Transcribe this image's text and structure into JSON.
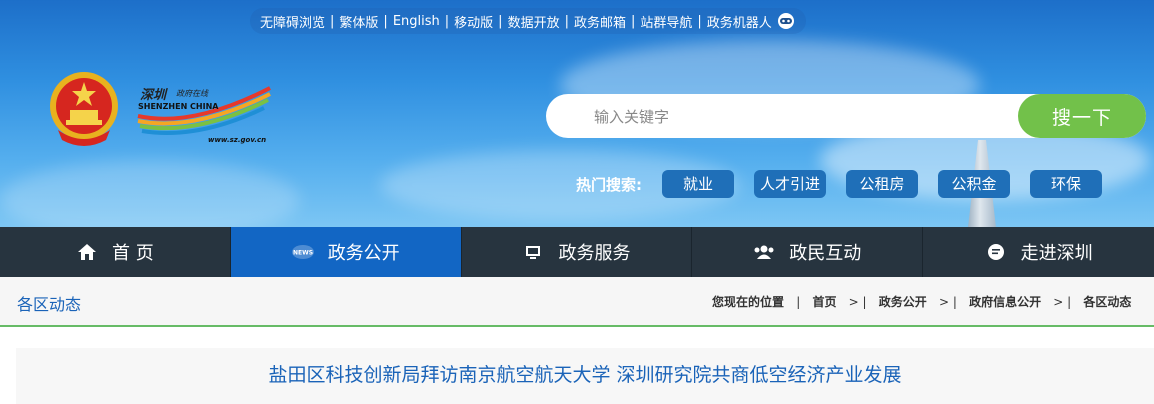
{
  "topbar": {
    "links": [
      "无障碍浏览",
      "繁体版",
      "English",
      "移动版",
      "数据开放",
      "政务邮箱",
      "站群导航",
      "政务机器人"
    ]
  },
  "logo": {
    "chinese": "深圳",
    "tagline": "政府在线",
    "english": "SHENZHEN CHINA",
    "url": "www.sz.gov.cn"
  },
  "search": {
    "placeholder": "输入关键字",
    "button": "搜一下"
  },
  "hot": {
    "label": "热门搜索:",
    "tags": [
      "就业",
      "人才引进",
      "公租房",
      "公积金",
      "环保"
    ]
  },
  "nav": {
    "items": [
      {
        "label": "首 页",
        "icon": "home-icon"
      },
      {
        "label": "政务公开",
        "icon": "news-icon"
      },
      {
        "label": "政务服务",
        "icon": "monitor-icon"
      },
      {
        "label": "政民互动",
        "icon": "people-icon"
      },
      {
        "label": "走进深圳",
        "icon": "chat-icon"
      }
    ],
    "active_index": 1
  },
  "breadcrumb": {
    "section": "各区动态",
    "prefix": "您现在的位置",
    "items": [
      "首页",
      "政务公开",
      "政府信息公开",
      "各区动态"
    ]
  },
  "article": {
    "title": "盐田区科技创新局拜访南京航空航天大学 深圳研究院共商低空经济产业发展"
  },
  "colors": {
    "nav_bg": "#27343f",
    "nav_active": "#1266c4",
    "search_btn": "#72c14a",
    "link_blue": "#1a63b8",
    "divider_green": "#66bb66"
  }
}
